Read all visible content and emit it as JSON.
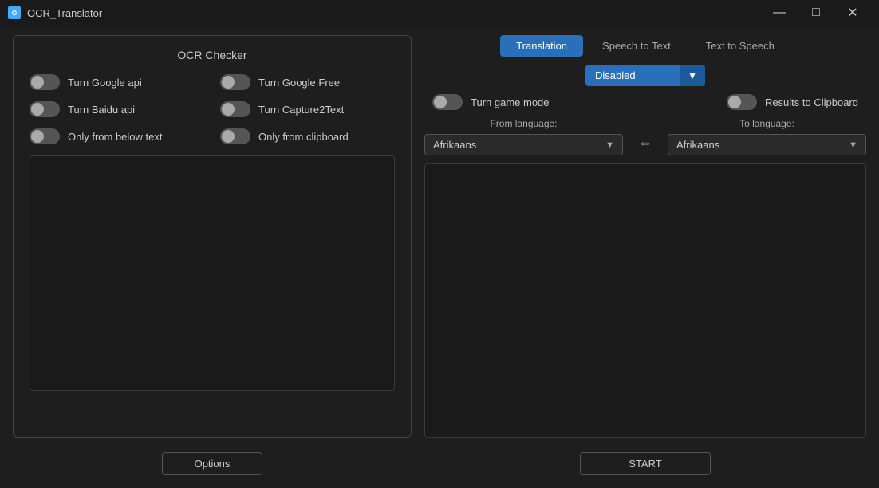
{
  "app": {
    "title": "OCR_Translator",
    "icon_label": "OCR"
  },
  "titlebar": {
    "minimize_label": "—",
    "maximize_label": "□",
    "close_label": "✕"
  },
  "left": {
    "ocr_checker_title": "OCR Checker",
    "toggles": [
      {
        "label": "Turn Google api",
        "enabled": false
      },
      {
        "label": "Turn Google Free",
        "enabled": false
      },
      {
        "label": "Turn Baidu api",
        "enabled": false
      },
      {
        "label": "Turn Capture2Text",
        "enabled": false
      },
      {
        "label": "Only from below text",
        "enabled": false
      },
      {
        "label": "Only from clipboard",
        "enabled": false
      }
    ],
    "options_btn_label": "Options"
  },
  "right": {
    "tabs": [
      {
        "label": "Translation",
        "active": true
      },
      {
        "label": "Speech to Text",
        "active": false
      },
      {
        "label": "Text to Speech",
        "active": false
      }
    ],
    "disabled_label": "Disabled",
    "dropdown_arrow": "▼",
    "game_mode_label": "Turn game mode",
    "clipboard_label": "Results to Clipboard",
    "from_lang_label": "From language:",
    "to_lang_label": "To language:",
    "from_lang_value": "Afrikaans",
    "to_lang_value": "Afrikaans",
    "swap_icon": "⇔",
    "start_btn_label": "START"
  }
}
